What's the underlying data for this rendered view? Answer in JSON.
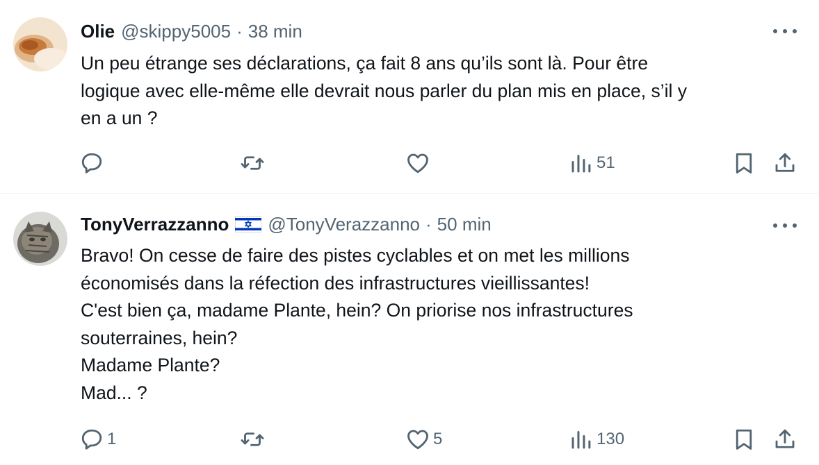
{
  "tweets": [
    {
      "author": {
        "name": "Olie",
        "handle": "@skippy5005",
        "flag": null
      },
      "time": "38 min",
      "separator": "·",
      "lines": [
        "Un peu étrange ses déclarations, ça fait 8 ans qu’ils sont là. Pour être",
        "logique avec elle-même elle devrait nous parler du plan mis en place, s’il y",
        "en a un ?"
      ],
      "stats": {
        "replies": "",
        "reposts": "",
        "likes": "",
        "views": "51"
      }
    },
    {
      "author": {
        "name": "TonyVerrazzanno",
        "handle": "@TonyVerazzanno",
        "flag": "israel-flag-icon"
      },
      "time": "50 min",
      "separator": "·",
      "lines": [
        "Bravo! On cesse de faire des pistes cyclables et on met les millions",
        "économisés dans la réfection des infrastructures vieillissantes!",
        "C'est bien ça, madame Plante, hein? On priorise nos infrastructures",
        "souterraines, hein?",
        "Madame Plante?",
        "Mad... ?"
      ],
      "stats": {
        "replies": "1",
        "reposts": "",
        "likes": "5",
        "views": "130"
      }
    }
  ],
  "colors": {
    "text": "#0f1419",
    "muted": "#536471",
    "divider": "#eff3f4",
    "flag_blue": "#0038b8"
  }
}
